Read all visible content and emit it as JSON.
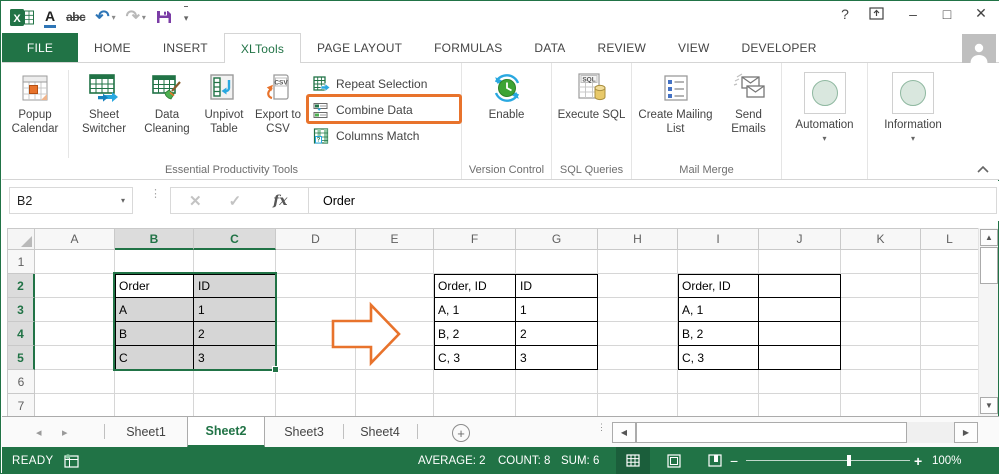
{
  "titlebar": {
    "help": "?",
    "qat": {
      "font_color_label": "A",
      "strikethrough_label": "abc"
    }
  },
  "tabs": {
    "items": [
      {
        "label": "FILE"
      },
      {
        "label": "HOME"
      },
      {
        "label": "INSERT"
      },
      {
        "label": "XLTools"
      },
      {
        "label": "PAGE LAYOUT"
      },
      {
        "label": "FORMULAS"
      },
      {
        "label": "DATA"
      },
      {
        "label": "REVIEW"
      },
      {
        "label": "VIEW"
      },
      {
        "label": "DEVELOPER"
      }
    ]
  },
  "ribbon": {
    "buttons": {
      "popup_calendar": "Popup Calendar",
      "sheet_switcher": "Sheet Switcher",
      "data_cleaning": "Data Cleaning",
      "unpivot_table": "Unpivot Table",
      "export_to_csv": "Export to CSV",
      "repeat_selection": "Repeat Selection",
      "combine_data": "Combine Data",
      "columns_match": "Columns Match",
      "enable": "Enable",
      "execute_sql": "Execute SQL",
      "create_mailing_list": "Create Mailing List",
      "send_emails": "Send Emails",
      "automation": "Automation",
      "information": "Information"
    },
    "group_labels": {
      "essential": "Essential Productivity Tools",
      "version_control": "Version Control",
      "sql_queries": "SQL Queries",
      "mail_merge": "Mail Merge"
    },
    "icon_texts": {
      "csv": "CSV",
      "sql": "SQL",
      "question": "?"
    },
    "highlight_color": "#E8732C"
  },
  "formula_bar": {
    "name_box": "B2",
    "fx": "fx",
    "formula": "Order"
  },
  "sheet": {
    "columns": [
      "A",
      "B",
      "C",
      "D",
      "E",
      "F",
      "G",
      "H",
      "I",
      "J",
      "K",
      "L"
    ],
    "rows": [
      "1",
      "2",
      "3",
      "4",
      "5",
      "6",
      "7"
    ],
    "selected_columns": [
      "B",
      "C"
    ],
    "selected_rows": [
      "2",
      "3",
      "4",
      "5"
    ],
    "active_cell": "B2",
    "selection_range": "B2:C5",
    "bordered_ranges": [
      "B2:C5",
      "F2:G5",
      "I2:J5"
    ],
    "cells": {
      "B2": "Order",
      "C2": "ID",
      "B3": "A",
      "C3": "1",
      "B4": "B",
      "C4": "2",
      "B5": "C",
      "C5": "3",
      "F2": "Order, ID",
      "G2": "ID",
      "F3": "A, 1",
      "G3": "1",
      "F4": "B, 2",
      "G4": "2",
      "F5": "C, 3",
      "G5": "3",
      "I2": "Order, ID",
      "I3": "A, 1",
      "I4": "B, 2",
      "I5": "C, 3"
    }
  },
  "sheet_tabs": {
    "tabs": [
      {
        "label": "Sheet1"
      },
      {
        "label": "Sheet2",
        "active": true
      },
      {
        "label": "Sheet3"
      },
      {
        "label": "Sheet4"
      }
    ],
    "add": "+"
  },
  "status_bar": {
    "mode": "READY",
    "average": "AVERAGE: 2",
    "count": "COUNT: 8",
    "sum": "SUM: 6",
    "zoom_level": "100%"
  },
  "colors": {
    "excel_green": "#217346",
    "accent_orange": "#E8732C",
    "selection_fill": "#D6D6D6"
  }
}
